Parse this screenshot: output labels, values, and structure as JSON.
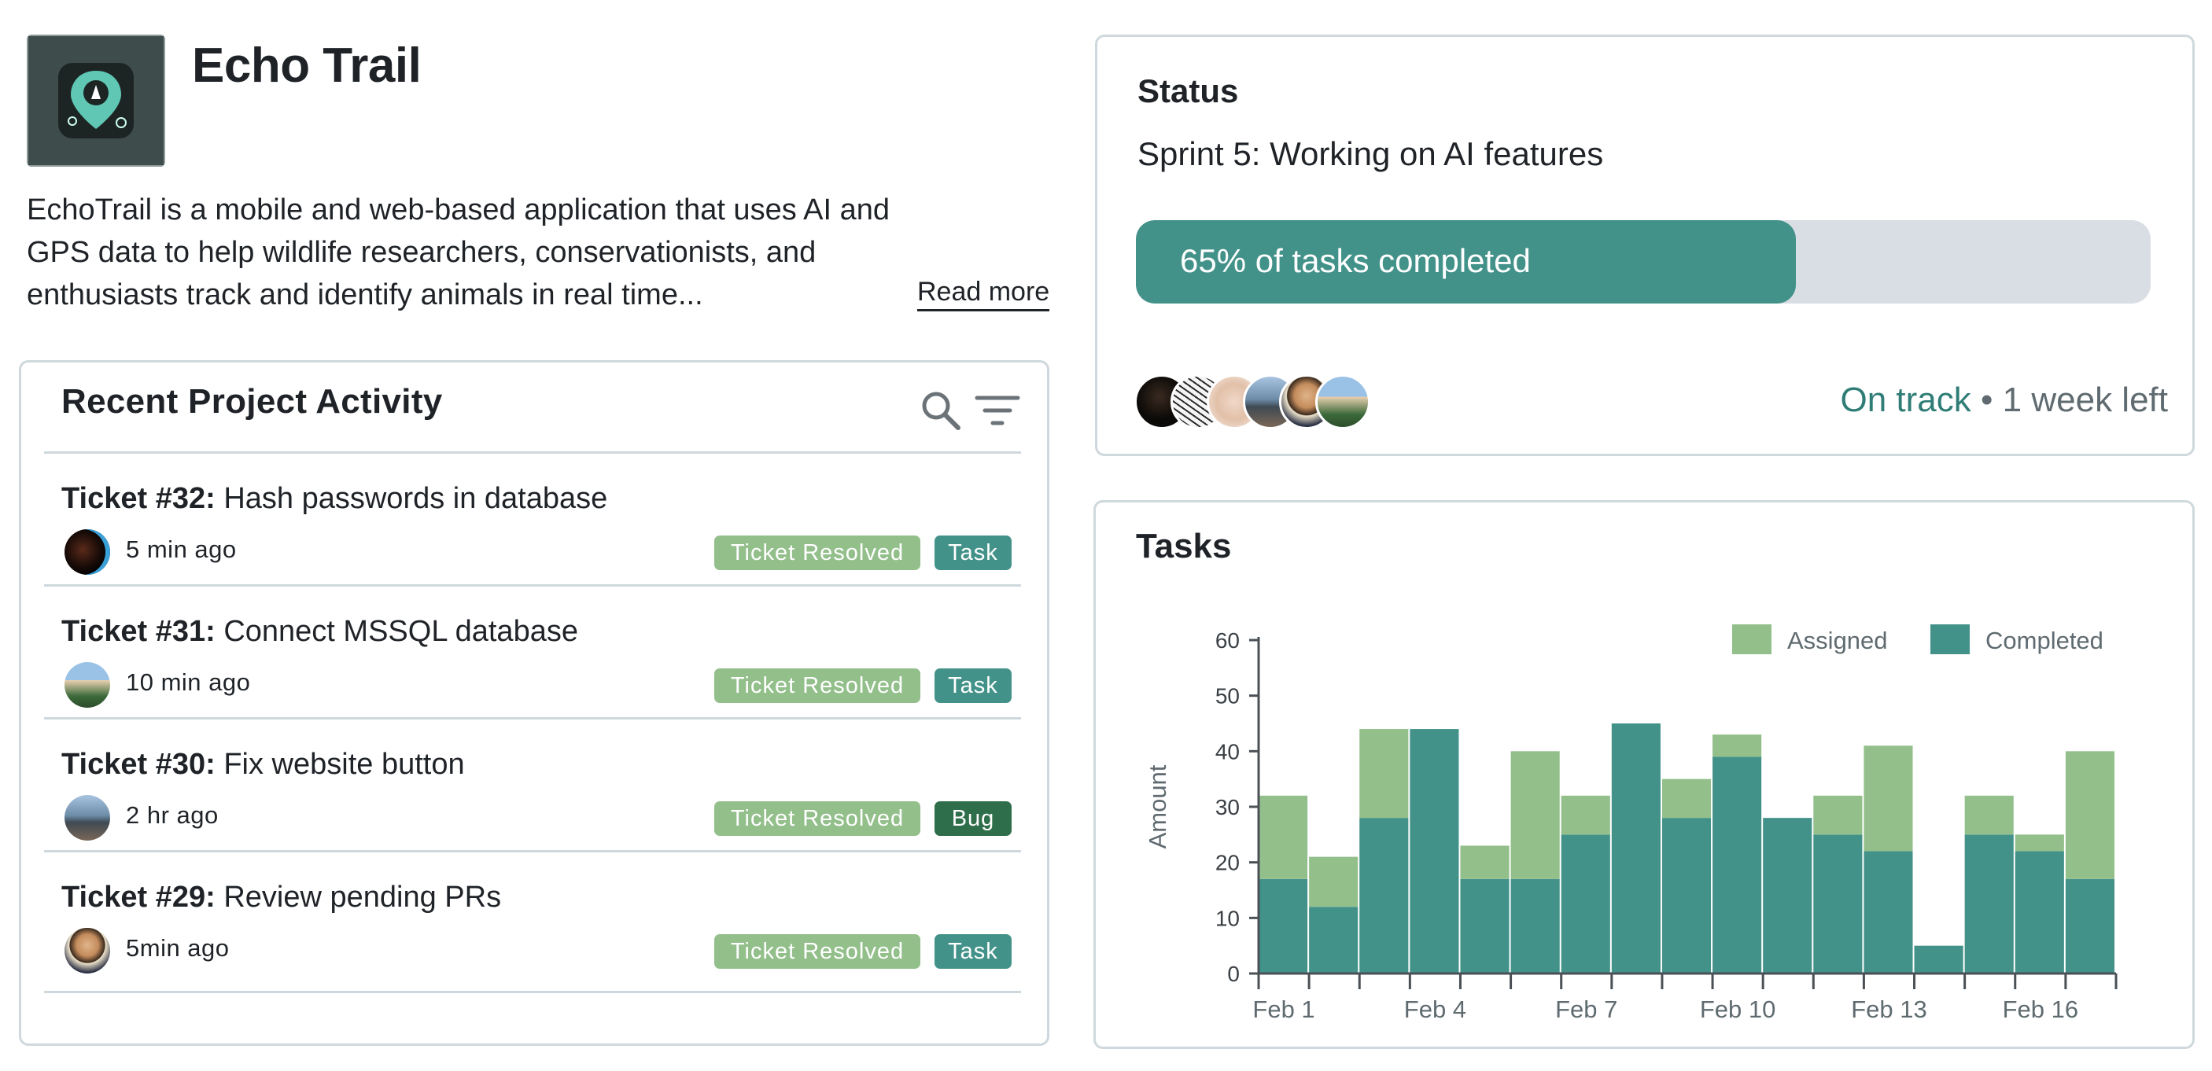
{
  "project": {
    "title": "Echo Trail",
    "icon": "trail-pin-logo-icon",
    "description": "EchoTrail is a mobile and web-based application that uses AI and GPS data to help wildlife researchers, conservationists, and enthusiasts track and identify animals in real time...",
    "read_more": "Read more"
  },
  "activity": {
    "title": "Recent Project Activity",
    "search_icon": "search-icon",
    "filter_icon": "filter-icon",
    "tickets": [
      {
        "number": "Ticket #32:",
        "summary": "Hash passwords in database",
        "time": "5 min ago",
        "status": "Ticket Resolved",
        "type": "Task",
        "type_color": "#43928a"
      },
      {
        "number": "Ticket #31:",
        "summary": "Connect MSSQL database",
        "time": "10 min ago",
        "status": "Ticket Resolved",
        "type": "Task",
        "type_color": "#43928a"
      },
      {
        "number": "Ticket #30:",
        "summary": "Fix website button",
        "time": "2 hr ago",
        "status": "Ticket Resolved",
        "type": "Bug",
        "type_color": "#2f6e4a"
      },
      {
        "number": "Ticket #29:",
        "summary": "Review pending PRs",
        "time": "5min ago",
        "status": "Ticket Resolved",
        "type": "Task",
        "type_color": "#43928a"
      }
    ]
  },
  "status": {
    "heading": "Status",
    "sprint": "Sprint 5: Working on AI features",
    "progress_percent": 65,
    "progress_label": "65% of tasks completed",
    "state": "On track",
    "separator": "•",
    "time_left": "1 week left",
    "team_size": 6
  },
  "tasks": {
    "heading": "Tasks"
  },
  "colors": {
    "accent": "#43928a",
    "assigned": "#93bf8b",
    "completed": "#43928a",
    "bug": "#2f6e4a",
    "border": "#cfd8dc"
  },
  "chart_data": {
    "type": "bar",
    "stacked": true,
    "categories": [
      "Feb 1",
      "Feb 2",
      "Feb 3",
      "Feb 4",
      "Feb 5",
      "Feb 6",
      "Feb 7",
      "Feb 8",
      "Feb 9",
      "Feb 10",
      "Feb 11",
      "Feb 12",
      "Feb 13",
      "Feb 14",
      "Feb 15",
      "Feb 16",
      "Feb 17"
    ],
    "tick_labels": [
      "Feb 1",
      "Feb 4",
      "Feb 7",
      "Feb 10",
      "Feb 13",
      "Feb 16"
    ],
    "series": [
      {
        "name": "Completed",
        "values": [
          17,
          12,
          28,
          44,
          17,
          17,
          25,
          45,
          28,
          39,
          28,
          25,
          22,
          5,
          25,
          22,
          17
        ]
      },
      {
        "name": "Assigned",
        "values": [
          15,
          9,
          16,
          0,
          6,
          23,
          7,
          0,
          7,
          4,
          0,
          7,
          19,
          0,
          7,
          3,
          23
        ]
      }
    ],
    "xlabel": "",
    "ylabel": "Amount",
    "ylim": [
      0,
      60
    ],
    "yticks": [
      0,
      10,
      20,
      30,
      40,
      50,
      60
    ],
    "legend": "top-right",
    "grid": false
  }
}
